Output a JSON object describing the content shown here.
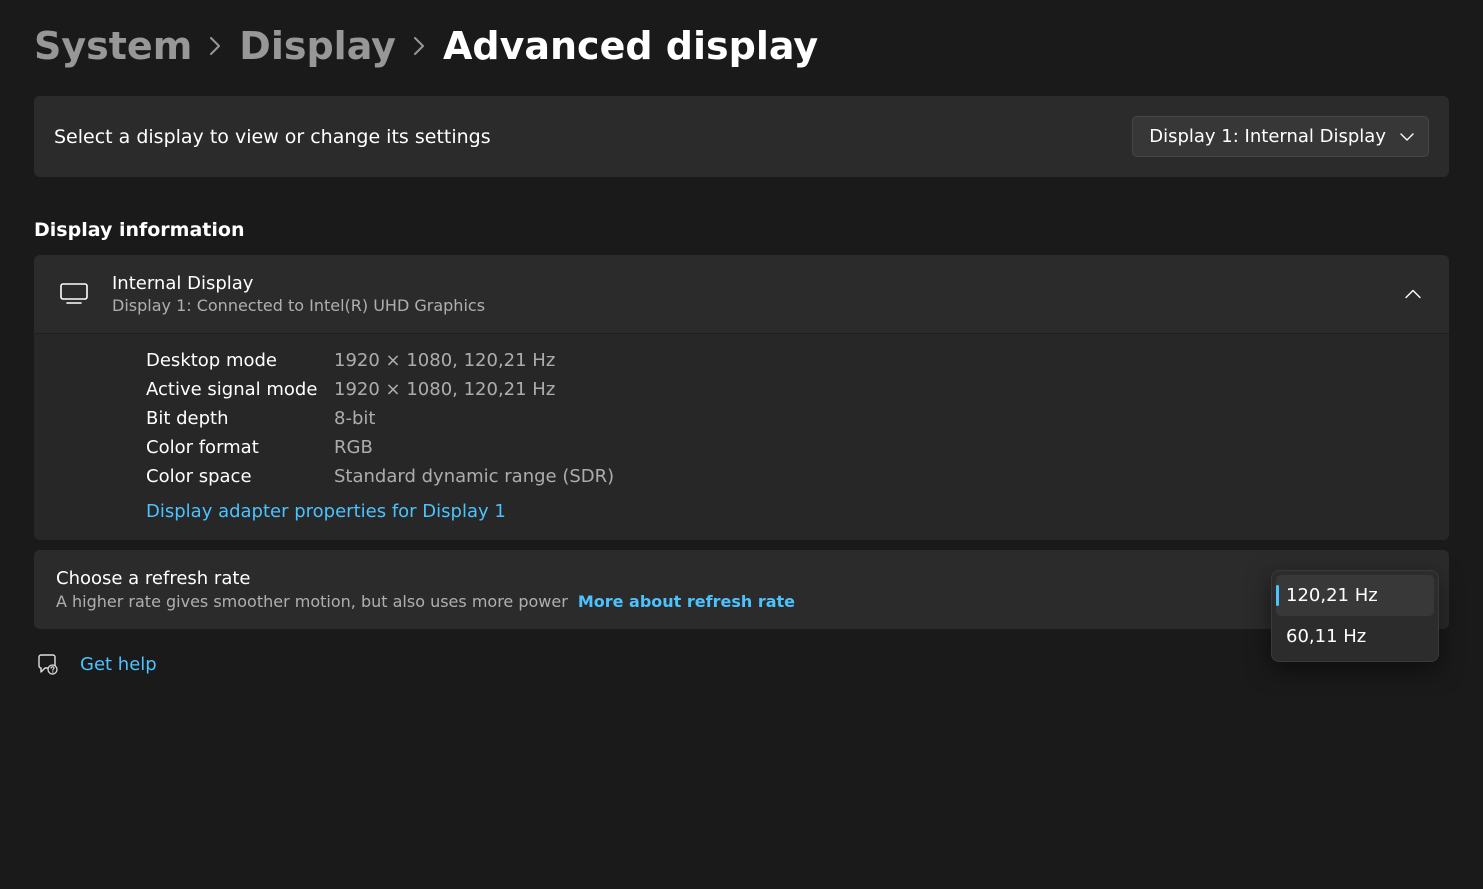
{
  "breadcrumbs": {
    "system": "System",
    "display": "Display",
    "current": "Advanced display"
  },
  "select_display": {
    "label": "Select a display to view or change its settings",
    "selected": "Display 1: Internal Display"
  },
  "section": {
    "heading": "Display information"
  },
  "info": {
    "title": "Internal Display",
    "subtitle": "Display 1: Connected to Intel(R) UHD Graphics",
    "rows": {
      "desktop_mode_label": "Desktop mode",
      "desktop_mode_value": "1920 × 1080, 120,21 Hz",
      "active_signal_label": "Active signal mode",
      "active_signal_value": "1920 × 1080, 120,21 Hz",
      "bit_depth_label": "Bit depth",
      "bit_depth_value": "8-bit",
      "color_format_label": "Color format",
      "color_format_value": "RGB",
      "color_space_label": "Color space",
      "color_space_value": "Standard dynamic range (SDR)"
    },
    "adapter_link": "Display adapter properties for Display 1"
  },
  "refresh": {
    "title": "Choose a refresh rate",
    "desc": "A higher rate gives smoother motion, but also uses more power",
    "more_link": "More about refresh rate",
    "options": {
      "opt1": "120,21 Hz",
      "opt2": "60,11 Hz"
    }
  },
  "help": {
    "label": "Get help"
  }
}
